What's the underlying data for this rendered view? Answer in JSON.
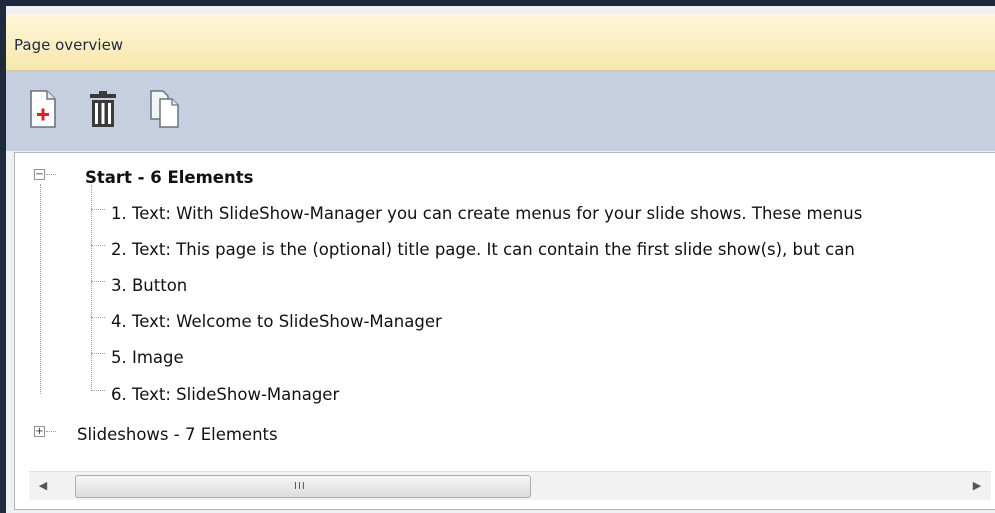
{
  "panel": {
    "title": "Page overview"
  },
  "toolbar": {
    "buttons": [
      {
        "name": "add-page",
        "icon": "add-page-icon"
      },
      {
        "name": "delete",
        "icon": "trash-icon"
      },
      {
        "name": "duplicate",
        "icon": "duplicate-icon"
      }
    ]
  },
  "tree": {
    "groups": [
      {
        "label": "Start - 6 Elements",
        "expanded": true,
        "expander": "−",
        "children": [
          "1. Text: With SlideShow-Manager you can create menus for your slide shows. These menus",
          "2. Text: This page is the (optional) title page. It can contain the first slide show(s), but can",
          "3. Button",
          "4. Text: Welcome to SlideShow-Manager",
          "5. Image",
          "6. Text: SlideShow-Manager"
        ]
      },
      {
        "label": "Slideshows - 7 Elements",
        "expanded": false,
        "expander": "+",
        "children": []
      }
    ]
  },
  "scrollbar": {
    "left_arrow": "◀",
    "right_arrow": "▶",
    "grip": "III"
  },
  "colors": {
    "header_gradient_top": "#fdf6d9",
    "header_gradient_bottom": "#f8e7ad",
    "toolbar_bg": "#c5cfdf",
    "frame": "#1f2a3c",
    "add_icon_accent": "#e02020"
  }
}
